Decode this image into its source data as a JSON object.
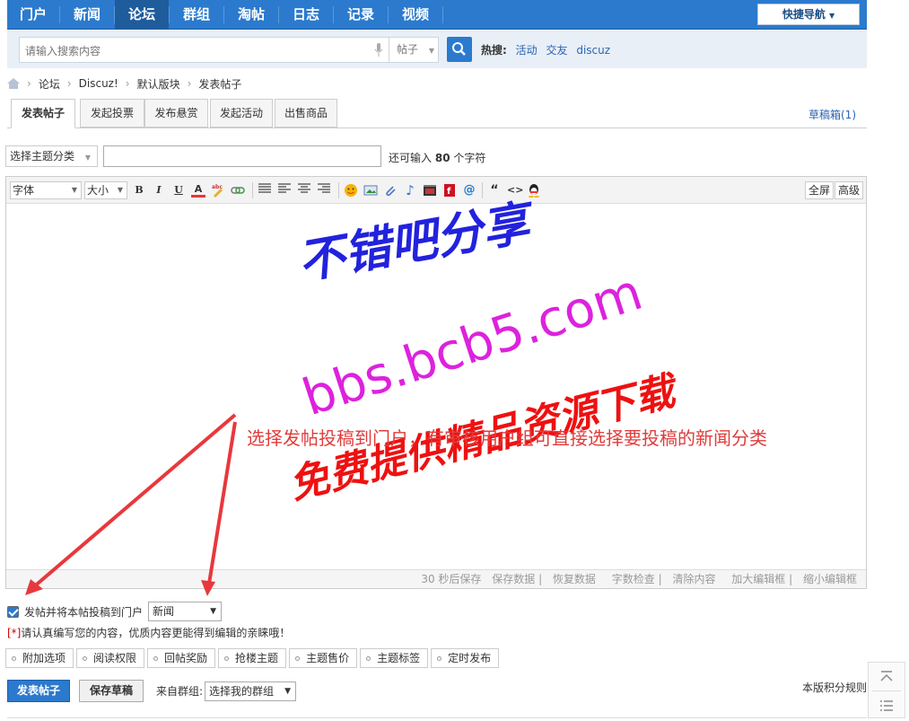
{
  "nav": {
    "items": [
      "门户",
      "新闻",
      "论坛",
      "群组",
      "淘帖",
      "日志",
      "记录",
      "视频"
    ],
    "active": "论坛",
    "quick_nav": "快捷导航"
  },
  "search": {
    "placeholder": "请输入搜索内容",
    "type": "帖子",
    "hot_label": "热搜:",
    "hot_keywords": [
      "活动",
      "交友",
      "discuz"
    ]
  },
  "breadcrumb": [
    "论坛",
    "Discuz!",
    "默认版块",
    "发表帖子"
  ],
  "tabs": [
    "发表帖子",
    "发起投票",
    "发布悬赏",
    "发起活动",
    "出售商品"
  ],
  "drafts_link": "草稿箱(1)",
  "title_row": {
    "category": "选择主题分类",
    "hint_prefix": "还可输入",
    "hint_count": "80",
    "hint_suffix": "个字符"
  },
  "toolbar": {
    "font": "字体",
    "size": "大小",
    "fullscreen": "全屏",
    "advanced": "高级"
  },
  "editor_footer": [
    "30 秒后保存",
    "保存数据",
    "恢复数据",
    "字数检查",
    "清除内容",
    "加大编辑框",
    "缩小编辑框"
  ],
  "overlay": {
    "watermark1": "不错吧分享",
    "watermark2": "bbs.bcb5.com",
    "watermark3": "免费提供精品资源下载",
    "note": "选择发帖投稿到门户，有审核用户组可直接选择要投稿的新闻分类"
  },
  "portal": {
    "label": "发帖并将本帖投稿到门户",
    "category": "新闻"
  },
  "notice": {
    "star": "[*]",
    "text": "请认真编写您的内容，优质内容更能得到编辑的亲睐哦！"
  },
  "options": [
    "附加选项",
    "阅读权限",
    "回帖奖励",
    "抢楼主题",
    "主题售价",
    "主题标签",
    "定时发布"
  ],
  "bottom": {
    "submit": "发表帖子",
    "save_draft": "保存草稿",
    "group_label": "来自群组:",
    "group_select": "选择我的群组",
    "rules": "本版积分规则"
  },
  "colors": {
    "nav_bg": "#2b7acd",
    "link": "#2b63b4",
    "arrow": "#e8383d"
  }
}
